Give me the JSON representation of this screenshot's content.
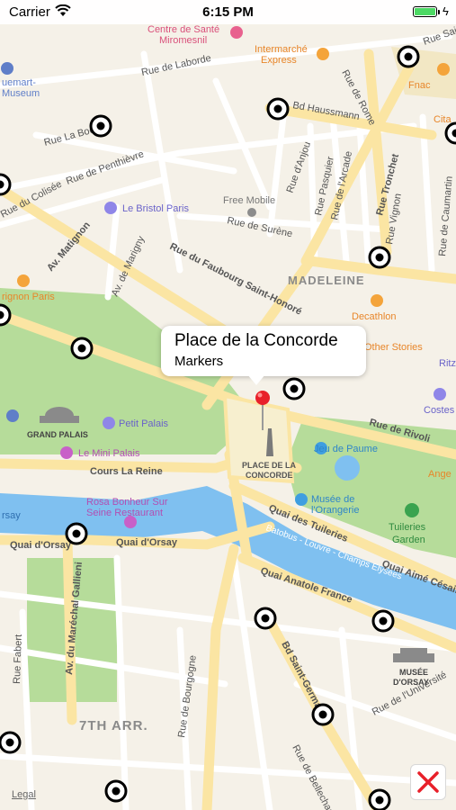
{
  "status_bar": {
    "carrier": "Carrier",
    "time": "6:15 PM",
    "battery_level": 1.0
  },
  "callout": {
    "title": "Place de la Concorde",
    "subtitle": "Markers"
  },
  "map": {
    "legal": "Legal",
    "street_labels": [
      "Rue de Laborde",
      "Bd Haussmann",
      "Rue de Rome",
      "Rue La Boétie",
      "Rue de Penthièvre",
      "Rue du Colisée",
      "Av. Matignon",
      "Av. de Marigny",
      "Rue du Faubourg Saint-Honoré",
      "Rue de Surène",
      "Rue d'Anjou",
      "Rue Pasquier",
      "Rue de l'Arcade",
      "Rue Tronchet",
      "Rue Vignon",
      "Rue de Caumartin",
      "Rue de Rivoli",
      "Cours La Reine",
      "Quai d'Orsay",
      "Quai d'Orsay",
      "Quai des Tuileries",
      "Quai Aimé Césaire",
      "Batobus - Louvre - Champs Elysées",
      "Quai Anatole France",
      "Av. du Maréchal Gallieni",
      "Rue de Bourgogne",
      "Bd Saint-Germain",
      "Rue de l'Université",
      "Rue de Bellechasse",
      "Rue Fabert",
      "Rue Saint-Lazare"
    ],
    "district_labels": [
      "MADELEINE",
      "7TH ARR.",
      "PLACE DE LA\nCONCORDE",
      "GRAND PALAIS",
      "MUSÉE\nD'ORSAY"
    ],
    "poi_labels": [
      "Centre de Santé\nMiromesnil",
      "Intermarché\nExpress",
      "Fnac",
      "Le Bristol Paris",
      "Free Mobile",
      "Decathlon",
      "& Other Stories",
      "Petit Palais",
      "Le Mini Palais",
      "Jeu de Paume",
      "Musée de\nl'Orangerie",
      "Tuileries\nGarden",
      "Rosa Bonheur Sur\nSeine Restaurant",
      "Jacquemart-\nMuseum",
      "Marignon Paris",
      "Citadium",
      "Ritz",
      "Costes",
      "Angelina",
      "Orsay"
    ],
    "marker_count": 18,
    "colors": {
      "land": "#f5f1e8",
      "park": "#b6dc9a",
      "water": "#7fc0f0",
      "road": "#ffffff",
      "major_road": "#fbe5a3",
      "pin": "#e8202a",
      "close_x": "#e8202a"
    }
  },
  "close_button": {
    "icon": "close-icon",
    "symbol": "✕"
  }
}
